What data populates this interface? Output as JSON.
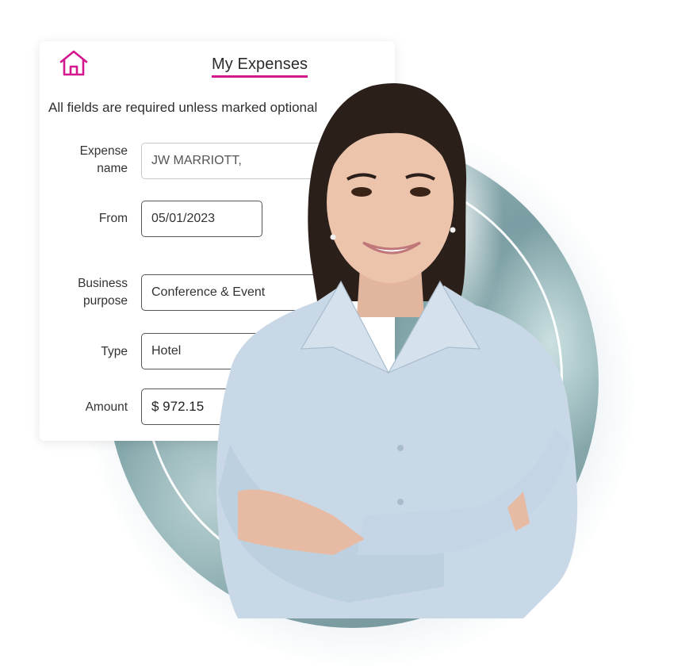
{
  "header": {
    "title": "My Expenses",
    "home_icon": "home-icon",
    "accent_color": "#d4168f"
  },
  "form": {
    "notice": "All fields are required unless marked optional",
    "fields": [
      {
        "label_line1": "Expense",
        "label_line2": "name",
        "value": "JW MARRIOTT,"
      },
      {
        "label_line1": "From",
        "label_line2": "",
        "value": "05/01/2023"
      },
      {
        "label_line1": "Business",
        "label_line2": "purpose",
        "value": "Conference & Event"
      },
      {
        "label_line1": "Type",
        "label_line2": "",
        "value": "Hotel"
      },
      {
        "label_line1": "Amount",
        "label_line2": "",
        "value": "$ 972.15"
      }
    ]
  },
  "hero": {
    "image_description": "smiling woman in light blue shirt with arms crossed"
  }
}
